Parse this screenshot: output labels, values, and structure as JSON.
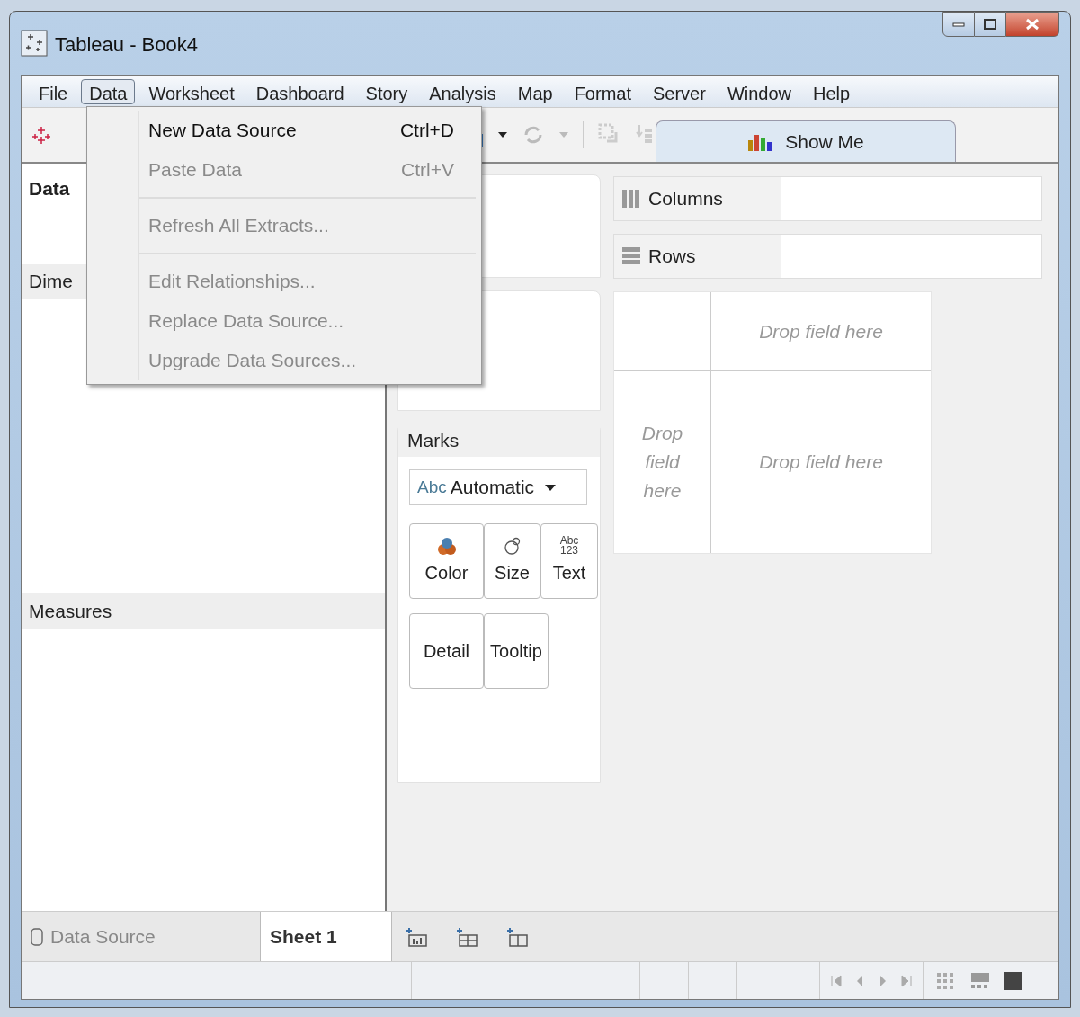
{
  "window": {
    "title": "Tableau - Book4"
  },
  "menu_bar": [
    {
      "label": "File",
      "selected": false
    },
    {
      "label": "Data",
      "selected": true
    },
    {
      "label": "Worksheet",
      "selected": false
    },
    {
      "label": "Dashboard",
      "selected": false
    },
    {
      "label": "Story",
      "selected": false
    },
    {
      "label": "Analysis",
      "selected": false
    },
    {
      "label": "Map",
      "selected": false
    },
    {
      "label": "Format",
      "selected": false
    },
    {
      "label": "Server",
      "selected": false
    },
    {
      "label": "Window",
      "selected": false
    },
    {
      "label": "Help",
      "selected": false
    }
  ],
  "data_menu": [
    {
      "label": "New Data Source",
      "shortcut": "Ctrl+D",
      "disabled": false,
      "separator_after": false
    },
    {
      "label": "Paste Data",
      "shortcut": "Ctrl+V",
      "disabled": true,
      "separator_after": true
    },
    {
      "label": "Refresh All Extracts...",
      "disabled": true,
      "separator_after": true
    },
    {
      "label": "Edit Relationships...",
      "disabled": true,
      "separator_after": false
    },
    {
      "label": "Replace Data Source...",
      "disabled": true,
      "separator_after": false
    },
    {
      "label": "Upgrade Data Sources...",
      "disabled": true,
      "separator_after": false
    }
  ],
  "toolbar": {
    "show_me": "Show Me"
  },
  "data_pane": {
    "title": "Data",
    "dimensions": "Dime",
    "measures": "Measures"
  },
  "marks": {
    "title": "Marks",
    "mark_type_icon": "Abc",
    "mark_type": "Automatic",
    "cards": [
      {
        "label": "Color",
        "kind": "color"
      },
      {
        "label": "Size",
        "kind": "size"
      },
      {
        "label": "Text",
        "kind": "text",
        "icon_text": [
          "Abc",
          "123"
        ]
      },
      {
        "label": "Detail",
        "kind": "plain"
      },
      {
        "label": "Tooltip",
        "kind": "plain"
      }
    ]
  },
  "shelves": [
    {
      "label": "Columns",
      "kind": "columns"
    },
    {
      "label": "Rows",
      "kind": "rows"
    }
  ],
  "view": {
    "top": "Drop field here",
    "left": "Drop field here",
    "center": "Drop field here"
  },
  "sheet_tabs": [
    {
      "label": "Data Source",
      "kind": "datasource",
      "selected": false
    },
    {
      "label": "Sheet 1",
      "kind": "sheet",
      "selected": true
    }
  ]
}
